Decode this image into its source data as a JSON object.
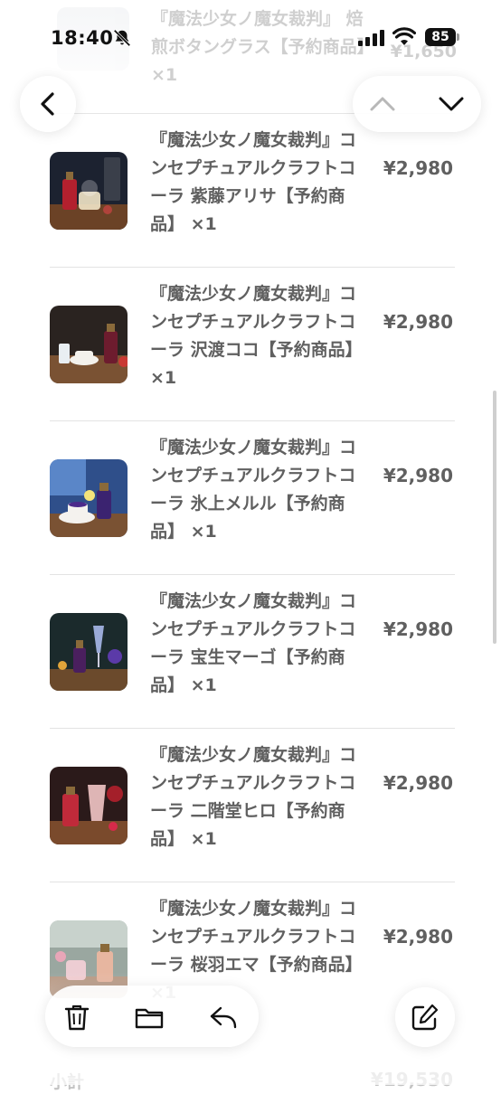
{
  "status_bar": {
    "time": "18:40",
    "battery": "85"
  },
  "ghost_item": {
    "title": "『魔法少女ノ魔女裁判』 焙煎ボタングラス【予約商品】×1",
    "price": "¥1,650"
  },
  "items": [
    {
      "title": "『魔法少女ノ魔女裁判』コンセプチュアルクラフトコーラ 紫藤アリサ【予約商品】 ×1",
      "price": "¥2,980"
    },
    {
      "title": "『魔法少女ノ魔女裁判』コンセプチュアルクラフトコーラ 沢渡ココ【予約商品】 ×1",
      "price": "¥2,980"
    },
    {
      "title": "『魔法少女ノ魔女裁判』コンセプチュアルクラフトコーラ 氷上メルル【予約商品】 ×1",
      "price": "¥2,980"
    },
    {
      "title": "『魔法少女ノ魔女裁判』コンセプチュアルクラフトコーラ 宝生マーゴ【予約商品】 ×1",
      "price": "¥2,980"
    },
    {
      "title": "『魔法少女ノ魔女裁判』コンセプチュアルクラフトコーラ 二階堂ヒロ【予約商品】 ×1",
      "price": "¥2,980"
    },
    {
      "title": "『魔法少女ノ魔女裁判』コンセプチュアルクラフトコーラ 桜羽エマ【予約商品】 ×1",
      "price": "¥2,980"
    }
  ],
  "subtotal": {
    "label": "小計",
    "value": "¥19,530"
  },
  "icons": {
    "nav": [
      "back-chevron-icon",
      "chevron-up-icon",
      "chevron-down-icon"
    ],
    "toolbar": [
      "trash-icon",
      "folder-icon",
      "reply-icon",
      "compose-icon"
    ]
  }
}
